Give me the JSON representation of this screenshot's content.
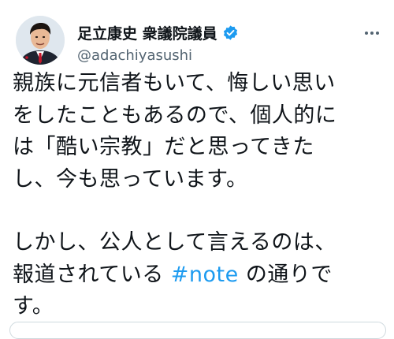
{
  "tweet": {
    "author": {
      "name": "足立康史 衆議院議員",
      "handle": "@adachiyasushi",
      "verified": true
    },
    "more_icon": "more-horizontal-icon",
    "text": {
      "line1": "親族に元信者もいて、悔しい思い",
      "line2": "をしたこともあるので、個人的に",
      "line3": "は「酷い宗教」だと思ってきた",
      "line4": "し、今も思っています。",
      "line5": "しかし、公人として言えるのは、",
      "line6_before": "報道されている ",
      "hashtag": "#note",
      "line6_after": " の通りで",
      "line7": "す。"
    }
  },
  "colors": {
    "text": "#0f1419",
    "handle": "#536471",
    "link": "#1d9bf0",
    "verified": "#1d9bf0"
  }
}
